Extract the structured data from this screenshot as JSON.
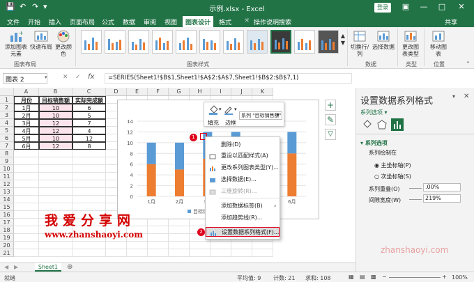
{
  "window": {
    "title": "示例.xlsx  -  Excel",
    "login": "登录"
  },
  "tabs": [
    "文件",
    "开始",
    "插入",
    "页面布局",
    "公式",
    "数据",
    "审阅",
    "视图",
    "图表设计",
    "格式",
    "操作说明搜索",
    "共享"
  ],
  "ribbon": {
    "buttons": [
      "添加图表元素",
      "快速布局",
      "更改颜色",
      "切换行/列",
      "选择数据",
      "更改图表类型",
      "移动图表"
    ],
    "groups": [
      "图表布局",
      "图表样式",
      "数据",
      "类型",
      "位置"
    ]
  },
  "formula_bar": {
    "name_box": "图表 2",
    "fx": "fx",
    "formula": "=SERIES(Sheet1!$B$1,Sheet1!$A$2:$A$7,Sheet1!$B$2:$B$7,1)"
  },
  "grid": {
    "columns": [
      "A",
      "B",
      "C",
      "D",
      "E",
      "F",
      "G",
      "H",
      "I",
      "J",
      "K"
    ],
    "rows": [
      "1",
      "2",
      "3",
      "4",
      "5",
      "6",
      "7",
      "8",
      "9",
      "10",
      "11",
      "12",
      "13",
      "14",
      "15",
      "16",
      "17",
      "18",
      "19",
      "20",
      "21"
    ],
    "headers": [
      "月份",
      "目标销售额",
      "实际完成额"
    ],
    "data": [
      [
        "1月",
        "10",
        "6"
      ],
      [
        "2月",
        "10",
        "5"
      ],
      [
        "3月",
        "12",
        "7"
      ],
      [
        "4月",
        "12",
        "4"
      ],
      [
        "5月",
        "10",
        "12"
      ],
      [
        "6月",
        "12",
        "8"
      ]
    ]
  },
  "chart_data": {
    "type": "bar",
    "categories": [
      "1月",
      "2月",
      "3月",
      "4月",
      "5月",
      "6月"
    ],
    "series": [
      {
        "name": "目标销售额",
        "values": [
          10,
          10,
          12,
          12,
          10,
          12
        ]
      },
      {
        "name": "实际完成额",
        "values": [
          6,
          5,
          7,
          4,
          12,
          8
        ]
      }
    ],
    "yticks": [
      "0",
      "2",
      "4",
      "6",
      "8",
      "10",
      "12",
      "14"
    ],
    "ylim": [
      0,
      14
    ],
    "legend_text": "目标销",
    "colors": {
      "series1": "#5b9bd5",
      "series2": "#ed7d31"
    }
  },
  "mini_toolbar": {
    "fill": "填充",
    "outline": "边框",
    "series_combo": "系列 \"目标销售额\""
  },
  "context_menu": {
    "items": [
      {
        "label": "删除(D)",
        "disabled": false
      },
      {
        "label": "重设以匹配样式(A)",
        "disabled": false
      },
      {
        "label": "更改系列图表类型(Y)...",
        "disabled": false
      },
      {
        "label": "选择数据(E)...",
        "disabled": false
      },
      {
        "label": "三维旋转(R)...",
        "disabled": true
      },
      {
        "label": "添加数据标签(B)",
        "disabled": false
      },
      {
        "label": "添加趋势线(R)...",
        "disabled": false
      },
      {
        "label": "设置数据系列格式(F)...",
        "disabled": false
      }
    ]
  },
  "badges": [
    "1",
    "2"
  ],
  "pane": {
    "title": "设置数据系列格式",
    "options_label": "系列选项",
    "section": "系列选项",
    "plot_on": "系列绘制在",
    "primary_axis": "主坐标轴(P)",
    "secondary_axis": "次坐标轴(S)",
    "overlap_label": "系列重叠(O)",
    "overlap_value": ".00%",
    "gap_label": "间隙宽度(W)",
    "gap_value": "219%"
  },
  "sheet_tab": "Sheet1",
  "status": {
    "ready": "就绪",
    "avg": "平均值: 9",
    "count": "计数: 21",
    "sum": "求和: 108",
    "zoom": "100%"
  },
  "watermark": {
    "cn": "我爱分享网",
    "url": "www.zhanshaoyi.com",
    "url2": "zhanshaoyi.com"
  }
}
